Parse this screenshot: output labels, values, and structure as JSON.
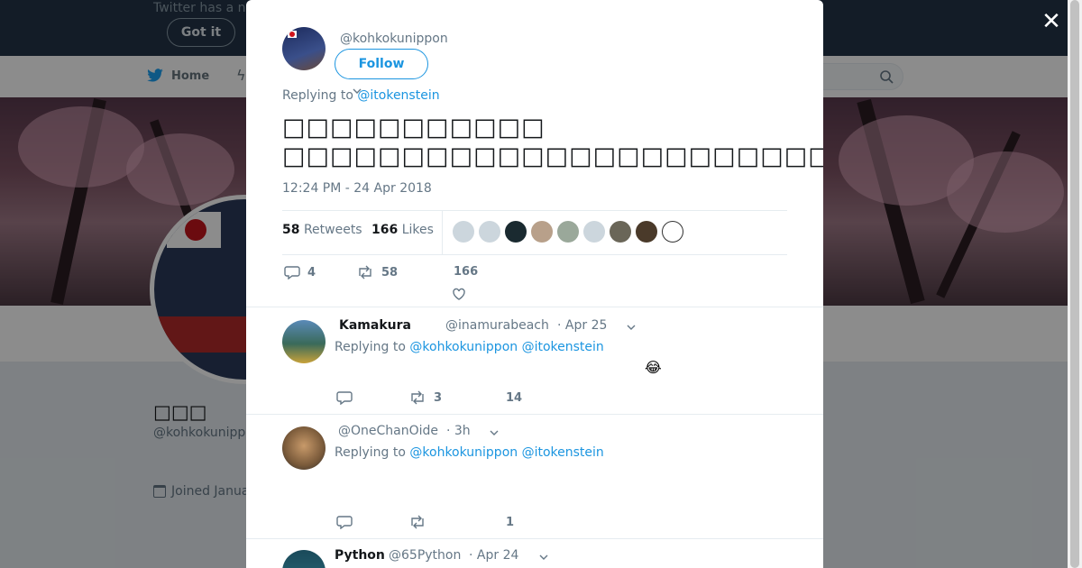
{
  "banner": {
    "message": "Twitter has a n",
    "got_it": "Got it"
  },
  "nav": {
    "home": "Home"
  },
  "profile": {
    "name": "□□□",
    "handle": "@kohkokunipp",
    "joined": "Joined Janua"
  },
  "modal": {
    "author_handle": "@kohkokunippon",
    "follow_label": "Follow",
    "replying_prefix": "Replying to",
    "replying_to": "@itokenstein",
    "tweet_line1": "□□□□□□□□□□□",
    "tweet_line2": "□□□□□□□□□□□□□□□□□□□□□□□□□",
    "timestamp": "12:24 PM - 24 Apr 2018",
    "retweets_count": "58",
    "retweets_label": "Retweets",
    "likes_count": "166",
    "likes_label": "Likes",
    "actions": {
      "replies": "4",
      "retweets": "58",
      "likes": "166"
    }
  },
  "replies": [
    {
      "name": "Kamakura",
      "handle": "@inamurabeach",
      "date": "· Apr 25",
      "replying_prefix": "Replying to",
      "to1": "@kohkokunippon",
      "to2": "@itokenstein",
      "emoji": "😂",
      "retweets": "3",
      "likes": "14"
    },
    {
      "name": "",
      "handle": "@OneChanOide",
      "date": "· 3h",
      "replying_prefix": "Replying to",
      "to1": "@kohkokunippon",
      "to2": "@itokenstein",
      "retweets": "",
      "likes": "1"
    },
    {
      "name": "Python",
      "handle": "@65Python",
      "date": "· Apr 24"
    }
  ],
  "colors": {
    "accent": "#1b95e0",
    "banner": "#243447",
    "text": "#14171a",
    "muted": "#657786"
  }
}
